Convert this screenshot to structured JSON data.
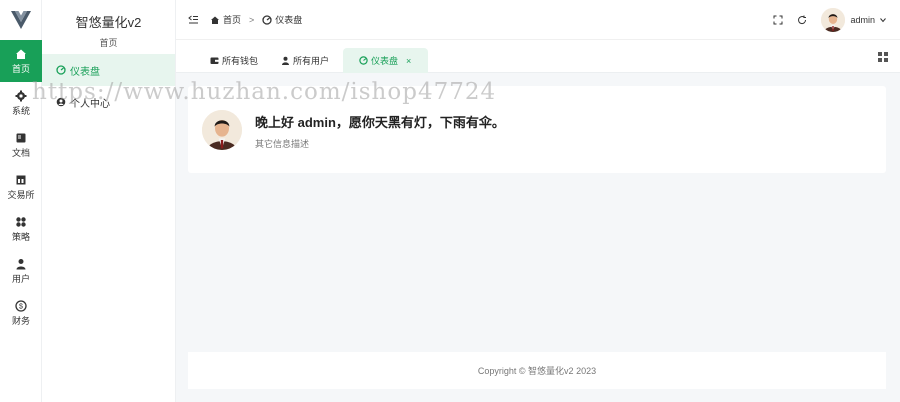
{
  "app": {
    "name": "智悠量化v2",
    "subtitle": "首页"
  },
  "rail": [
    {
      "label": "首页",
      "icon": "home-icon",
      "active": true
    },
    {
      "label": "系统",
      "icon": "gear-icon"
    },
    {
      "label": "文档",
      "icon": "book-icon"
    },
    {
      "label": "交易所",
      "icon": "building-icon"
    },
    {
      "label": "策略",
      "icon": "apps-icon"
    },
    {
      "label": "用户",
      "icon": "user-icon"
    },
    {
      "label": "财务",
      "icon": "dollar-icon"
    }
  ],
  "submenu": [
    {
      "label": "仪表盘",
      "icon": "dashboard-icon",
      "active": true
    },
    {
      "label": "个人中心",
      "icon": "user-circle-icon"
    }
  ],
  "header": {
    "breadcrumb": [
      {
        "label": "首页",
        "icon": "home-icon"
      },
      {
        "label": "仪表盘",
        "icon": "dashboard-icon"
      }
    ],
    "separator": ">",
    "username": "admin"
  },
  "tabs": [
    {
      "label": "所有钱包",
      "icon": "wallet-icon"
    },
    {
      "label": "所有用户",
      "icon": "user-icon"
    },
    {
      "label": "仪表盘",
      "icon": "dashboard-icon",
      "active": true,
      "close": "×"
    }
  ],
  "welcome": {
    "greeting": "晚上好 admin，愿你天黑有灯，下雨有伞。",
    "description": "其它信息描述"
  },
  "footer": {
    "copyright": "Copyright © 智悠量化v2 2023"
  },
  "watermark": "https://www.huzhan.com/ishop47724",
  "colors": {
    "primary": "#18a058",
    "active_bg": "#e7f5ee",
    "page_bg": "#f5f7f9"
  }
}
